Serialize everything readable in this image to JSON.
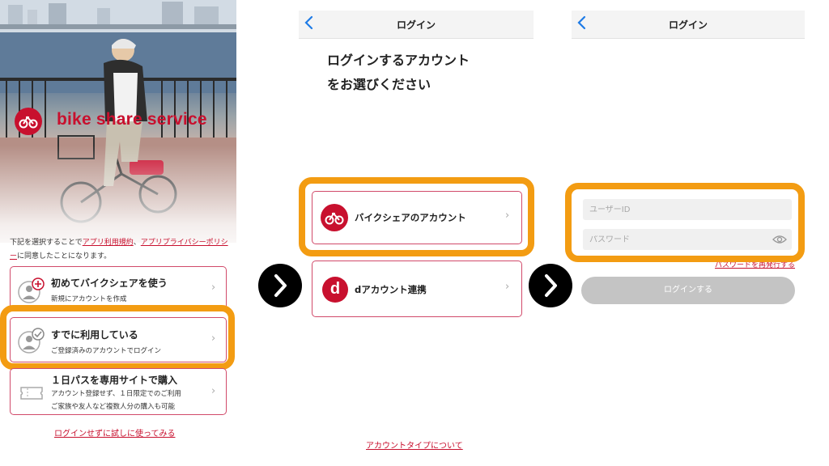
{
  "panel1": {
    "brand": "bike share service",
    "terms": {
      "prefix": "下記を選択することで",
      "link1": "アプリ利用規約",
      "sep": "、",
      "link2": "アプリプライバシーポリシー",
      "suffix": "に同意したことになります。"
    },
    "options": [
      {
        "title": "初めてバイクシェアを使う",
        "subtitle": "新規にアカウントを作成"
      },
      {
        "title": "すでに利用している",
        "subtitle": "ご登録済みのアカウントでログイン"
      },
      {
        "title": "１日パスを専用サイトで購入",
        "subtitle": "アカウント登録せず、１日限定でのご利用",
        "subtitle2": "ご家族や友人など複数人分の購入も可能"
      }
    ],
    "try_link": "ログインせずに試しに使ってみる"
  },
  "panel2": {
    "nav_title": "ログイン",
    "heading_line1": "ログインするアカウント",
    "heading_line2": "をお選びください",
    "option1": "バイクシェアのアカウント",
    "option2": "dアカウント連携",
    "footer_link": "アカウントタイプについて"
  },
  "panel3": {
    "nav_title": "ログイン",
    "user_placeholder": "ユーザーID",
    "password_placeholder": "パスワード",
    "reset_link": "パスワードを再発行する",
    "login_button": "ログインする"
  },
  "icons": {
    "back": "chevron-left-icon",
    "next": "chevron-right-icon",
    "eye": "eye-icon"
  },
  "colors": {
    "brand_red": "#c8102e",
    "highlight_orange": "#f39c12",
    "ios_blue": "#1e7be6",
    "docomo_red": "#c8102e"
  }
}
